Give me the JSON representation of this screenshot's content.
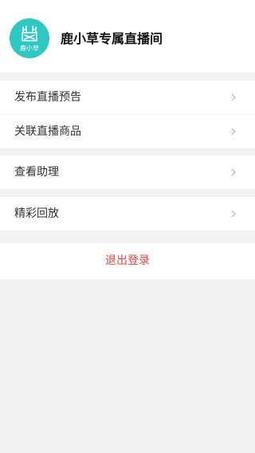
{
  "header": {
    "title": "鹿小草专属直播间",
    "logo_text": "鹿小草",
    "logo_color": "#2fc7c1"
  },
  "menu": {
    "group1": [
      {
        "label": "发布直播预告",
        "icon": "chevron-right-icon"
      },
      {
        "label": "关联直播商品",
        "icon": "chevron-right-icon"
      }
    ],
    "group2": [
      {
        "label": "查看助理",
        "icon": "chevron-right-icon"
      }
    ],
    "group3": [
      {
        "label": "精彩回放",
        "icon": "chevron-right-icon"
      }
    ]
  },
  "logout": {
    "label": "退出登录",
    "color": "#e8473f"
  }
}
